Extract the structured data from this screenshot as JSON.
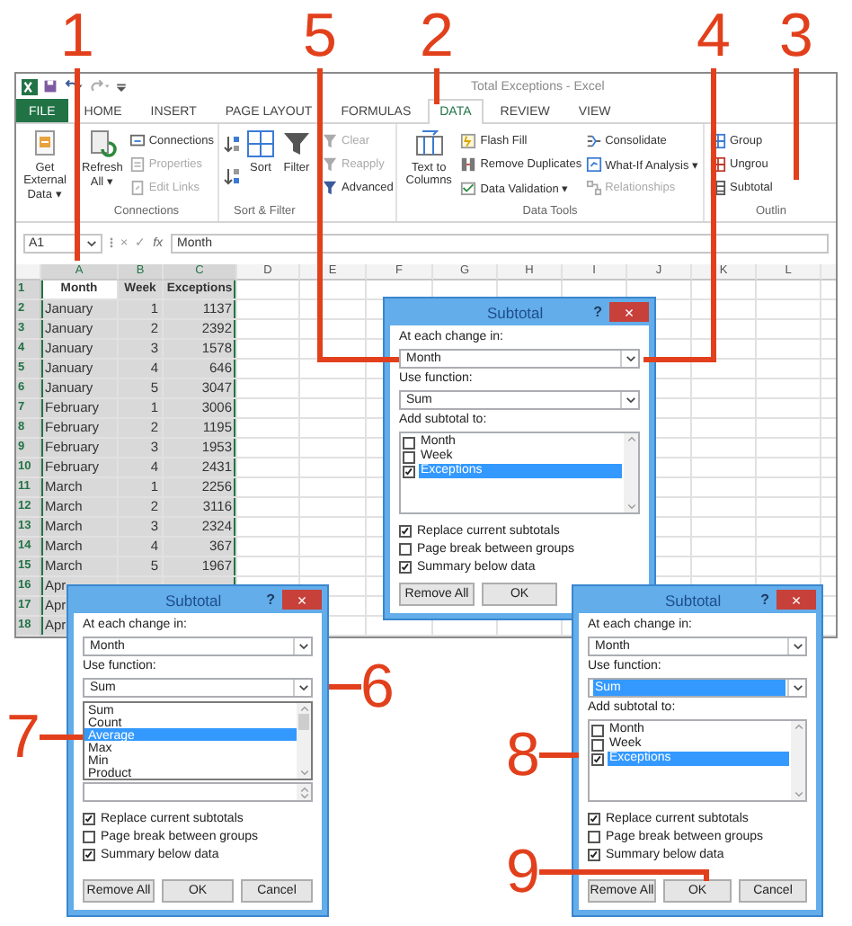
{
  "excel": {
    "title": "Total Exceptions - Excel",
    "tabs": [
      {
        "label": "FILE",
        "kind": "file",
        "selected": false
      },
      {
        "label": "HOME",
        "kind": "tab",
        "selected": false
      },
      {
        "label": "INSERT",
        "kind": "tab",
        "selected": false
      },
      {
        "label": "PAGE LAYOUT",
        "kind": "tab",
        "selected": false
      },
      {
        "label": "FORMULAS",
        "kind": "tab",
        "selected": false
      },
      {
        "label": "DATA",
        "kind": "tab",
        "selected": true
      },
      {
        "label": "REVIEW",
        "kind": "tab",
        "selected": false
      },
      {
        "label": "VIEW",
        "kind": "tab",
        "selected": false
      }
    ],
    "ribbon": {
      "groups": [
        {
          "columns": [
            [
              {
                "kind": "large",
                "label": "Get External Data ▾",
                "disabled": false
              }
            ]
          ]
        },
        {
          "label": "Connections",
          "columns": [
            [
              {
                "kind": "large",
                "label": "Refresh All ▾",
                "disabled": false
              }
            ],
            [
              {
                "kind": "small",
                "label": "Connections",
                "disabled": false
              },
              {
                "kind": "small",
                "label": "Properties",
                "disabled": true
              },
              {
                "kind": "small",
                "label": "Edit Links",
                "disabled": true
              }
            ]
          ]
        },
        {
          "label": "Sort & Filter",
          "columns": [
            [
              {
                "kind": "icon",
                "disabled": false
              },
              {
                "kind": "icon",
                "disabled": false
              }
            ],
            [
              {
                "kind": "large",
                "label": "Sort",
                "disabled": false
              }
            ],
            [
              {
                "kind": "large",
                "label": "Filter",
                "disabled": false
              }
            ],
            [
              {
                "kind": "small",
                "label": "Clear",
                "disabled": true
              },
              {
                "kind": "small",
                "label": "Reapply",
                "disabled": true
              },
              {
                "kind": "small",
                "label": "Advanced",
                "disabled": false
              }
            ]
          ]
        },
        {
          "label": "Data Tools",
          "columns": [
            [
              {
                "kind": "large",
                "label": "Text to Columns",
                "disabled": false
              }
            ],
            [
              {
                "kind": "small",
                "label": "Flash Fill",
                "disabled": false
              },
              {
                "kind": "small",
                "label": "Remove Duplicates",
                "disabled": false
              },
              {
                "kind": "small",
                "label": "Data Validation ▾",
                "disabled": false
              }
            ],
            [
              {
                "kind": "small",
                "label": "Consolidate",
                "disabled": false
              },
              {
                "kind": "small",
                "label": "What-If Analysis ▾",
                "disabled": false
              },
              {
                "kind": "small",
                "label": "Relationships",
                "disabled": true
              }
            ]
          ]
        },
        {
          "label": "Outlin",
          "columns": [
            [
              {
                "kind": "small",
                "label": "Group",
                "disabled": false
              },
              {
                "kind": "small",
                "label": "Ungrou",
                "disabled": false
              },
              {
                "kind": "small",
                "label": "Subtotal",
                "disabled": false
              }
            ]
          ]
        }
      ]
    },
    "formula_bar": {
      "name_box": "A1",
      "cancel_symbol": "×",
      "enter_symbol": "✓",
      "function_symbol": "fx",
      "formula": "Month"
    },
    "sheet": {
      "columns": [
        {
          "label": "A",
          "selected": true
        },
        {
          "label": "B",
          "selected": true
        },
        {
          "label": "C",
          "selected": true
        },
        {
          "label": "D",
          "selected": false
        },
        {
          "label": "E",
          "selected": false
        },
        {
          "label": "F",
          "selected": false
        },
        {
          "label": "G",
          "selected": false
        },
        {
          "label": "H",
          "selected": false
        },
        {
          "label": "I",
          "selected": false
        },
        {
          "label": "J",
          "selected": false
        },
        {
          "label": "K",
          "selected": false
        },
        {
          "label": "L",
          "selected": false
        }
      ],
      "rows": [
        {
          "number": "1",
          "kind": "header",
          "selected": true,
          "active": true,
          "cells": [
            "Month",
            "Week",
            "Exceptions"
          ]
        },
        {
          "number": "2",
          "kind": "data",
          "selected": true,
          "active": false,
          "cells": [
            "January",
            "1",
            "1137"
          ]
        },
        {
          "number": "3",
          "kind": "data",
          "selected": true,
          "active": false,
          "cells": [
            "January",
            "2",
            "2392"
          ]
        },
        {
          "number": "4",
          "kind": "data",
          "selected": true,
          "active": false,
          "cells": [
            "January",
            "3",
            "1578"
          ]
        },
        {
          "number": "5",
          "kind": "data",
          "selected": true,
          "active": false,
          "cells": [
            "January",
            "4",
            "646"
          ]
        },
        {
          "number": "6",
          "kind": "data",
          "selected": true,
          "active": false,
          "cells": [
            "January",
            "5",
            "3047"
          ]
        },
        {
          "number": "7",
          "kind": "data",
          "selected": true,
          "active": false,
          "cells": [
            "February",
            "1",
            "3006"
          ]
        },
        {
          "number": "8",
          "kind": "data",
          "selected": true,
          "active": false,
          "cells": [
            "February",
            "2",
            "1195"
          ]
        },
        {
          "number": "9",
          "kind": "data",
          "selected": true,
          "active": false,
          "cells": [
            "February",
            "3",
            "1953"
          ]
        },
        {
          "number": "10",
          "kind": "data",
          "selected": true,
          "active": false,
          "cells": [
            "February",
            "4",
            "2431"
          ]
        },
        {
          "number": "11",
          "kind": "data",
          "selected": true,
          "active": false,
          "cells": [
            "March",
            "1",
            "2256"
          ]
        },
        {
          "number": "12",
          "kind": "data",
          "selected": true,
          "active": false,
          "cells": [
            "March",
            "2",
            "3116"
          ]
        },
        {
          "number": "13",
          "kind": "data",
          "selected": true,
          "active": false,
          "cells": [
            "March",
            "3",
            "2324"
          ]
        },
        {
          "number": "14",
          "kind": "data",
          "selected": true,
          "active": false,
          "cells": [
            "March",
            "4",
            "367"
          ]
        },
        {
          "number": "15",
          "kind": "data",
          "selected": true,
          "active": false,
          "cells": [
            "March",
            "5",
            "1967"
          ]
        },
        {
          "number": "16",
          "kind": "data",
          "selected": true,
          "active": false,
          "cells": [
            "Apr"
          ]
        },
        {
          "number": "17",
          "kind": "data",
          "selected": true,
          "active": false,
          "cells": [
            "Apr"
          ]
        },
        {
          "number": "18",
          "kind": "data",
          "selected": true,
          "active": false,
          "cells": [
            "Apr"
          ]
        }
      ]
    }
  },
  "dialogs": [
    {
      "title": "Subtotal",
      "help": "?",
      "close": "×",
      "change_label": "At each change in:",
      "change_value": "Month",
      "function_label": "Use function:",
      "function_value": "Sum",
      "function_focused": false,
      "add_label": "Add subtotal to:",
      "fields": [
        {
          "label": "Month",
          "checked": false,
          "selected": false
        },
        {
          "label": "Week",
          "checked": false,
          "selected": false
        },
        {
          "label": "Exceptions",
          "checked": true,
          "selected": true
        }
      ],
      "options": [
        {
          "label": "Replace current subtotals",
          "checked": true
        },
        {
          "label": "Page break between groups",
          "checked": false
        },
        {
          "label": "Summary below data",
          "checked": true
        }
      ],
      "buttons": [
        "Remove All",
        "OK"
      ]
    },
    {
      "title": "Subtotal",
      "help": "?",
      "close": "×",
      "change_label": "At each change in:",
      "change_value": "Month",
      "function_label": "Use function:",
      "function_value": "Sum",
      "function_focused": false,
      "function_options": [
        {
          "label": "Sum",
          "selected": false
        },
        {
          "label": "Count",
          "selected": false
        },
        {
          "label": "Average",
          "selected": true
        },
        {
          "label": "Max",
          "selected": false
        },
        {
          "label": "Min",
          "selected": false
        },
        {
          "label": "Product",
          "selected": false
        }
      ],
      "options": [
        {
          "label": "Replace current subtotals",
          "checked": true
        },
        {
          "label": "Page break between groups",
          "checked": false
        },
        {
          "label": "Summary below data",
          "checked": true
        }
      ],
      "buttons": [
        "Remove All",
        "OK",
        "Cancel"
      ]
    },
    {
      "title": "Subtotal",
      "help": "?",
      "close": "×",
      "change_label": "At each change in:",
      "change_value": "Month",
      "function_label": "Use function:",
      "function_value": "Sum",
      "function_focused": true,
      "add_label": "Add subtotal to:",
      "fields": [
        {
          "label": "Month",
          "checked": false,
          "selected": false
        },
        {
          "label": "Week",
          "checked": false,
          "selected": false
        },
        {
          "label": "Exceptions",
          "checked": true,
          "selected": true
        }
      ],
      "options": [
        {
          "label": "Replace current subtotals",
          "checked": true
        },
        {
          "label": "Page break between groups",
          "checked": false
        },
        {
          "label": "Summary below data",
          "checked": true
        }
      ],
      "buttons": [
        "Remove All",
        "OK",
        "Cancel"
      ]
    }
  ],
  "callouts": [
    {
      "label": "1"
    },
    {
      "label": "5"
    },
    {
      "label": "2"
    },
    {
      "label": "4"
    },
    {
      "label": "3"
    },
    {
      "label": "6"
    },
    {
      "label": "7"
    },
    {
      "label": "8"
    },
    {
      "label": "9"
    }
  ]
}
